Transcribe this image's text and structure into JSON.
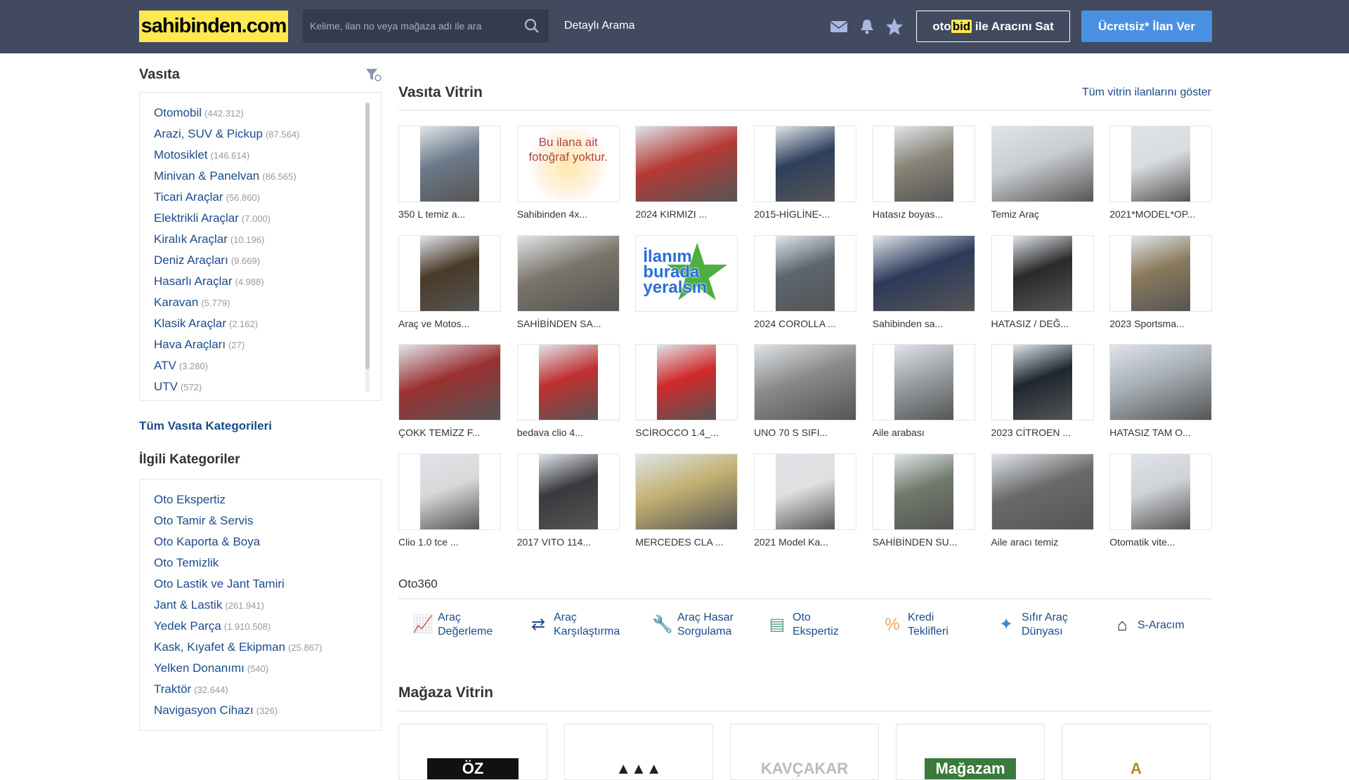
{
  "header": {
    "logo": "sahibinden.com",
    "search_placeholder": "Kelime, ilan no veya mağaza adı ile ara",
    "detailed_search": "Detaylı Arama",
    "otobid_prefix": "oto",
    "otobid_highlight": "bid",
    "otobid_suffix": " ile Aracını Sat",
    "post_ad": "Ücretsiz* İlan Ver"
  },
  "sidebar": {
    "title": "Vasıta",
    "categories": [
      {
        "label": "Otomobil",
        "count": "(442.312)"
      },
      {
        "label": "Arazi, SUV & Pickup",
        "count": "(87.564)"
      },
      {
        "label": "Motosiklet",
        "count": "(146.614)"
      },
      {
        "label": "Minivan & Panelvan",
        "count": "(86.565)"
      },
      {
        "label": "Ticari Araçlar",
        "count": "(56.860)"
      },
      {
        "label": "Elektrikli Araçlar",
        "count": "(7.000)"
      },
      {
        "label": "Kiralık Araçlar",
        "count": "(10.196)"
      },
      {
        "label": "Deniz Araçları",
        "count": "(9.669)"
      },
      {
        "label": "Hasarlı Araçlar",
        "count": "(4.988)"
      },
      {
        "label": "Karavan",
        "count": "(5.779)"
      },
      {
        "label": "Klasik Araçlar",
        "count": "(2.162)"
      },
      {
        "label": "Hava Araçları",
        "count": "(27)"
      },
      {
        "label": "ATV",
        "count": "(3.280)"
      },
      {
        "label": "UTV",
        "count": "(572)"
      }
    ],
    "all_categories": "Tüm Vasıta Kategorileri",
    "related_title": "İlgili Kategoriler",
    "related": [
      {
        "label": "Oto Ekspertiz",
        "count": ""
      },
      {
        "label": "Oto Tamir & Servis",
        "count": ""
      },
      {
        "label": "Oto Kaporta & Boya",
        "count": ""
      },
      {
        "label": "Oto Temizlik",
        "count": ""
      },
      {
        "label": "Oto Lastik ve Jant Tamiri",
        "count": ""
      },
      {
        "label": "Jant & Lastik",
        "count": "(261.941)"
      },
      {
        "label": "Yedek Parça",
        "count": "(1.910.508)"
      },
      {
        "label": "Kask, Kıyafet & Ekipman",
        "count": "(25.867)"
      },
      {
        "label": "Yelken Donanımı",
        "count": "(540)"
      },
      {
        "label": "Traktör",
        "count": "(32.644)"
      },
      {
        "label": "Navigasyon Cihazı",
        "count": "(326)"
      }
    ]
  },
  "showcase": {
    "title": "Vasıta Vitrin",
    "show_all": "Tüm vitrin ilanlarını göster",
    "items": [
      {
        "caption": "350 L temiz a...",
        "color": "#6d7a8a"
      },
      {
        "caption": "Sahibinden 4x...",
        "nophoto": "Bu ilana ait fotoğraf yoktur."
      },
      {
        "caption": "2024 KIRMIZI ...",
        "color": "#b53a35"
      },
      {
        "caption": "2015-HİGLİNE-...",
        "color": "#2e3f5c"
      },
      {
        "caption": "Hatasız boyas...",
        "color": "#8a8578"
      },
      {
        "caption": "Temiz Araç",
        "color": "#c9ccd0"
      },
      {
        "caption": "2021*MODEL*OP...",
        "color": "#d9dcdf"
      },
      {
        "caption": "Araç ve Motos...",
        "color": "#4a3a28"
      },
      {
        "caption": "SAHİBİNDEN SA...",
        "color": "#7a7468"
      },
      {
        "caption": "",
        "promo": [
          "İlanım",
          "burada",
          "yeralsın"
        ]
      },
      {
        "caption": "2024 COROLLA ...",
        "color": "#5c6670"
      },
      {
        "caption": "Sahibinden sa...",
        "color": "#2c3a5a"
      },
      {
        "caption": "HATASIZ / DEĞ...",
        "color": "#2a2a2a"
      },
      {
        "caption": "2023 Sportsma...",
        "color": "#8a7a5c"
      },
      {
        "caption": "ÇOKK TEMİZZ F...",
        "color": "#9a3030"
      },
      {
        "caption": "bedava clio 4...",
        "color": "#c03030"
      },
      {
        "caption": "SCİROCCO 1.4_...",
        "color": "#d02a2a"
      },
      {
        "caption": "UNO 70 S SIFI...",
        "color": "#8a8a88"
      },
      {
        "caption": "Aile arabası",
        "color": "#9aa0a4"
      },
      {
        "caption": "2023 CİTROEN ...",
        "color": "#1e2630"
      },
      {
        "caption": "HATASIZ TAM O...",
        "color": "#a6aeb4"
      },
      {
        "caption": "Clio 1.0 tce ...",
        "color": "#d8d8d8"
      },
      {
        "caption": "2017 VITO 114...",
        "color": "#3a3a3e"
      },
      {
        "caption": "MERCEDES CLA ...",
        "color": "#c2b070"
      },
      {
        "caption": "2021 Model Ka...",
        "color": "#e0e0e0"
      },
      {
        "caption": "SAHİBİNDEN SU...",
        "color": "#707a6a"
      },
      {
        "caption": "Aile aracı temiz",
        "color": "#6a6a6a"
      },
      {
        "caption": "Otomatik vite...",
        "color": "#cfd2d6"
      }
    ]
  },
  "oto360": {
    "title": "Oto360",
    "items": [
      {
        "line1": "Araç",
        "line2": "Değerleme",
        "icon": "chart-up-icon",
        "glyph": "📈",
        "color": "#4a90e2"
      },
      {
        "line1": "Araç",
        "line2": "Karşılaştırma",
        "icon": "compare-arrows-icon",
        "glyph": "⇄",
        "color": "#1c4b8c"
      },
      {
        "line1": "Araç Hasar",
        "line2": "Sorgulama",
        "icon": "wrench-icon",
        "glyph": "🔧",
        "color": "#2e6e7a"
      },
      {
        "line1": "Oto",
        "line2": "Ekspertiz",
        "icon": "report-search-icon",
        "glyph": "▤",
        "color": "#5a9a8a"
      },
      {
        "line1": "Kredi",
        "line2": "Teklifleri",
        "icon": "percent-icon",
        "glyph": "%",
        "color": "#f0a060"
      },
      {
        "line1": "Sıfır Araç",
        "line2": "Dünyası",
        "icon": "sparkle-icon",
        "glyph": "✦",
        "color": "#3a8ad6"
      },
      {
        "line1": "S-Aracım",
        "line2": "",
        "icon": "garage-icon",
        "glyph": "⌂",
        "color": "#222"
      }
    ]
  },
  "stores": {
    "title": "Mağaza Vitrin",
    "items": [
      {
        "logo": "ÖZ",
        "bg": "#111",
        "fg": "#fff"
      },
      {
        "logo": "▲▲▲",
        "bg": "#fff",
        "fg": "#222"
      },
      {
        "logo": "KAVÇAKAR",
        "bg": "#fff",
        "fg": "#bbb"
      },
      {
        "logo": "Mağazam",
        "bg": "#3a7a3a",
        "fg": "#fff"
      },
      {
        "logo": "A",
        "bg": "#fff",
        "fg": "#b08a30"
      }
    ]
  }
}
